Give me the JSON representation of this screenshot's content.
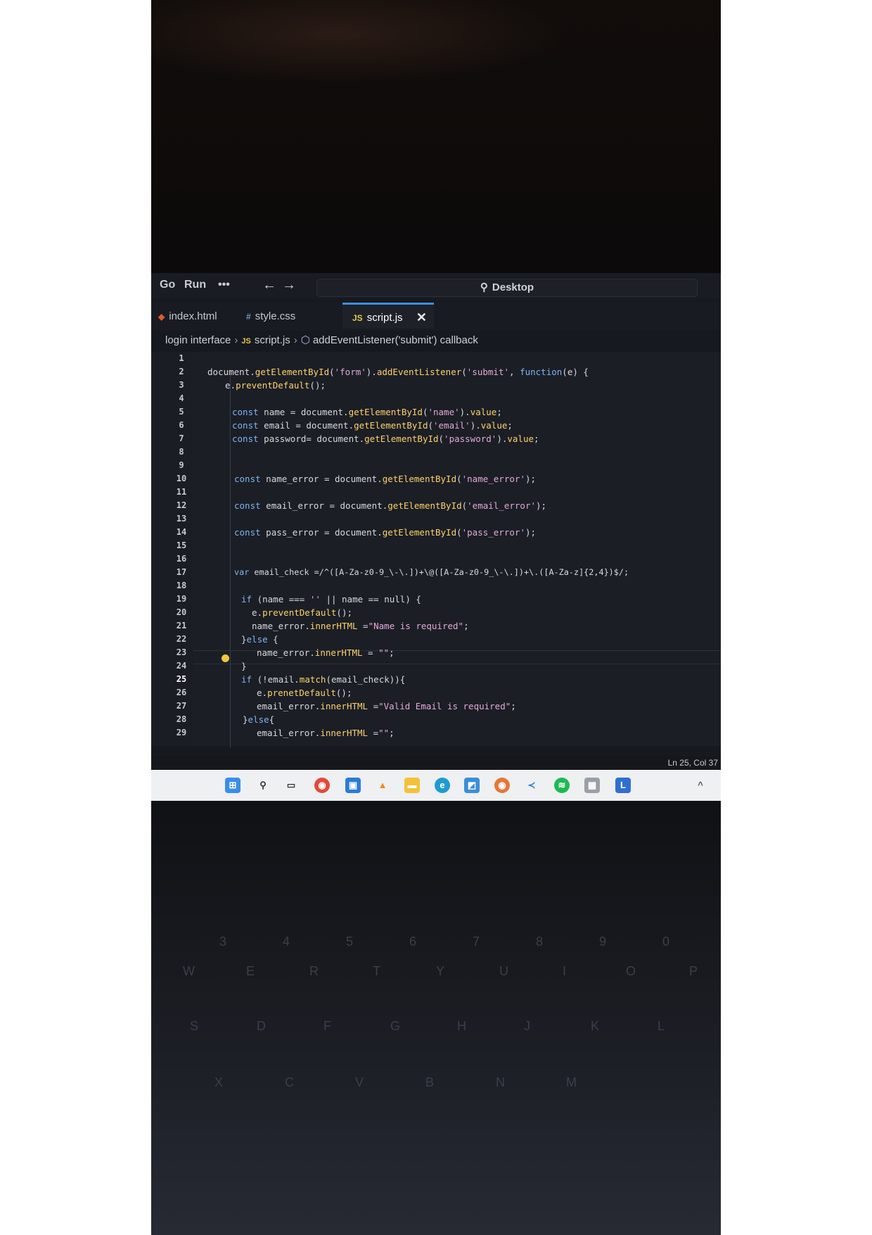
{
  "menu": {
    "go": "Go",
    "run": "Run",
    "more": "•••",
    "back_icon": "arrow-left-icon",
    "forward_icon": "arrow-right-icon"
  },
  "search": {
    "label": "Desktop"
  },
  "tabs": [
    {
      "label": "index.html",
      "icon": "html-icon",
      "icon_color": "#e05a2b"
    },
    {
      "label": "style.css",
      "icon": "css-icon",
      "icon_color": "#6b9ac8"
    },
    {
      "label": "script.js",
      "icon": "js-icon",
      "icon_color": "#e6c84b",
      "active": true
    }
  ],
  "breadcrumb": {
    "folder": "login interface",
    "file": "script.js",
    "symbol": "addEventListener('submit') callback"
  },
  "editor": {
    "line_numbers": [
      "1",
      "2",
      "3",
      "4",
      "5",
      "6",
      "7",
      "8",
      "9",
      "10",
      "11",
      "12",
      "13",
      "14",
      "15",
      "16",
      "17",
      "18",
      "19",
      "20",
      "21",
      "22",
      "23",
      "24",
      "25",
      "26",
      "27",
      "28",
      "29"
    ],
    "current_line": 25,
    "lines": [
      {
        "n": 2,
        "text": "document.getElementById('form').addEventListener('submit', function(e) {"
      },
      {
        "n": 3,
        "text": "e.preventDefault();"
      },
      {
        "n": 5,
        "text": "const name = document.getElementById('name').value;"
      },
      {
        "n": 6,
        "text": "const email = document.getElementById('email').value;"
      },
      {
        "n": 7,
        "text": "const password= document.getElementById('password').value;"
      },
      {
        "n": 10,
        "text": "const name_error = document.getElementById('name_error');"
      },
      {
        "n": 12,
        "text": "const email_error = document.getElementById('email_error');"
      },
      {
        "n": 14,
        "text": "const pass_error = document.getElementById('pass_error');"
      },
      {
        "n": 17,
        "text": "var email_check =/^([A-Za-z0-9_\\-\\.])+\\@([A-Za-z0-9_\\-\\.])+\\.([A-Za-z]{2,4})$/;"
      },
      {
        "n": 19,
        "text": "if (name === '' || name == null) {"
      },
      {
        "n": 20,
        "text": "e.preventDefault();"
      },
      {
        "n": 21,
        "text": "name_error.innerHTML =\"Name is required\";"
      },
      {
        "n": 22,
        "text": "}else {"
      },
      {
        "n": 23,
        "text": "name_error.innerHTML = \"\";"
      },
      {
        "n": 24,
        "text": "}"
      },
      {
        "n": 25,
        "text": "if (!email.match(email_check)){"
      },
      {
        "n": 26,
        "text": "e.prenetDefault();"
      },
      {
        "n": 27,
        "text": "email_error.innerHTML =\"Valid Email is required\";"
      },
      {
        "n": 28,
        "text": "}else{"
      },
      {
        "n": 29,
        "text": "email_error.innerHTML =\"\";"
      }
    ]
  },
  "status": {
    "cursor": "Ln 25, Col 37"
  },
  "taskbar": {
    "icons": [
      "windows-start-icon",
      "search-icon",
      "task-view-icon",
      "chrome-icon",
      "store-icon",
      "vlc-icon",
      "file-explorer-icon",
      "edge-icon",
      "photos-icon",
      "chrome-profile-icon",
      "vscode-icon",
      "spotify-icon",
      "calculator-icon",
      "teams-icon"
    ]
  },
  "keyboard": {
    "keys": [
      "3",
      "4",
      "5",
      "6",
      "7",
      "8",
      "9",
      "0",
      "W",
      "E",
      "R",
      "T",
      "Y",
      "U",
      "I",
      "O",
      "P",
      "S",
      "D",
      "F",
      "G",
      "H",
      "J",
      "K",
      "L",
      "X",
      "C",
      "V",
      "B",
      "N",
      "M"
    ]
  },
  "colors": {
    "accent": "#3b8fe0",
    "keyword": "#7fb4f5",
    "property": "#ffd26a",
    "string": "#e4a8d8"
  }
}
